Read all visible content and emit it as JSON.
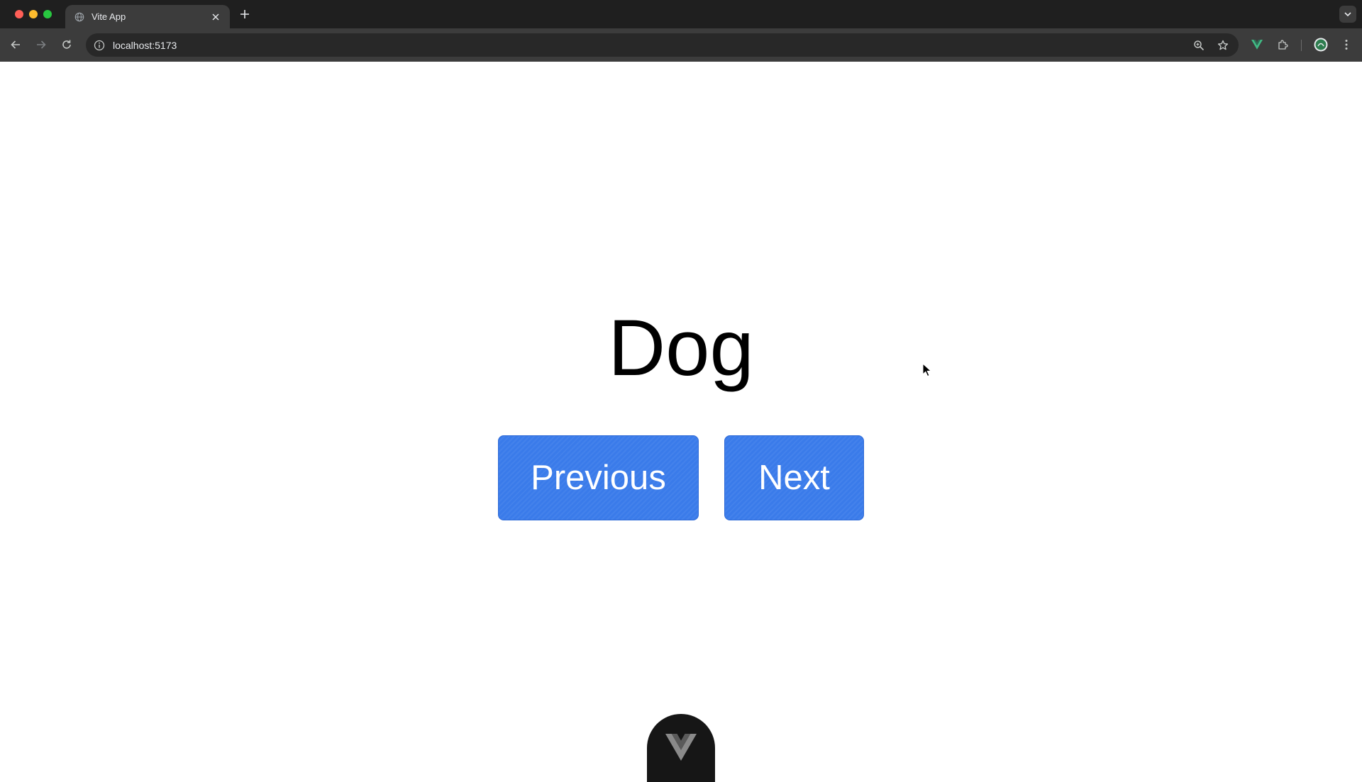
{
  "browser": {
    "tab": {
      "title": "Vite App",
      "icons": [
        "globe-icon",
        "close-icon"
      ]
    },
    "toolbar": {
      "url": "localhost:5173",
      "icons": [
        "back-icon",
        "forward-icon",
        "reload-icon",
        "info-icon",
        "zoom-icon",
        "star-icon",
        "vue-devtools-icon",
        "extensions-icon",
        "profile-avatar",
        "more-icon"
      ]
    },
    "traffic_lights": {
      "close": "#ff5f57",
      "minimize": "#febc2e",
      "maximize": "#28c840"
    }
  },
  "page": {
    "word": "Dog",
    "buttons": {
      "previous": "Previous",
      "next": "Next"
    },
    "colors": {
      "button_bg": "#3a7bea",
      "text": "#000000",
      "background": "#ffffff"
    },
    "devtools_icon": "vue-logo-icon"
  }
}
